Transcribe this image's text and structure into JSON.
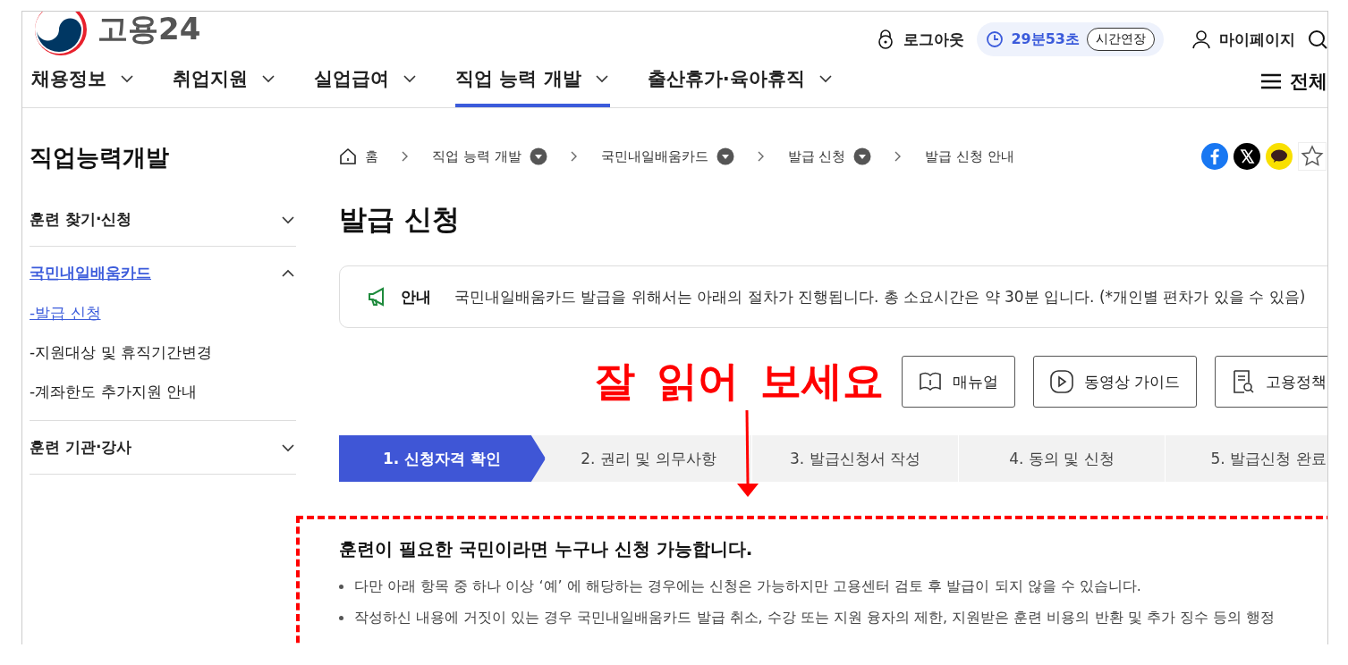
{
  "header": {
    "logo_text": "고용24",
    "utility": [
      {
        "kind": "logout",
        "label": "로그아웃"
      },
      {
        "kind": "timer",
        "label": "29분53초",
        "action": "시간연장"
      },
      {
        "kind": "mypage",
        "label": "마이페이지"
      },
      {
        "kind": "search"
      }
    ]
  },
  "nav": {
    "items": [
      {
        "label": "채용정보",
        "selected": false
      },
      {
        "label": "취업지원",
        "selected": false
      },
      {
        "label": "실업급여",
        "selected": false
      },
      {
        "label": "직업 능력 개발",
        "selected": true
      },
      {
        "label": "출산휴가·육아휴직",
        "selected": false
      }
    ],
    "all_menu": "전체"
  },
  "sidebar": {
    "title": "직업능력개발",
    "items": [
      {
        "label": "훈련 찾기·신청",
        "expanded": false,
        "selected": false
      },
      {
        "label": "국민내일배움카드",
        "expanded": true,
        "selected": true,
        "children": [
          {
            "label": "-발급 신청",
            "selected": true
          },
          {
            "label": "-지원대상 및 휴직기간변경",
            "selected": false
          },
          {
            "label": "-계좌한도 추가지원 안내",
            "selected": false
          }
        ]
      },
      {
        "label": "훈련 기관·강사",
        "expanded": false,
        "selected": false
      }
    ]
  },
  "breadcrumb": [
    {
      "label": "홈",
      "kind": "home"
    },
    {
      "label": "직업 능력 개발",
      "kind": "dropdown"
    },
    {
      "label": "국민내일배움카드",
      "kind": "dropdown"
    },
    {
      "label": "발급 신청",
      "kind": "dropdown"
    },
    {
      "label": "발급 신청 안내",
      "kind": "plain"
    }
  ],
  "share": [
    {
      "kind": "facebook"
    },
    {
      "kind": "x"
    },
    {
      "kind": "talk"
    },
    {
      "kind": "star"
    }
  ],
  "page_title": "발급 신청",
  "notice": {
    "label": "안내",
    "text": "국민내일배움카드 발급을 위해서는 아래의 절차가 진행됩니다. 총 소요시간은 약 30분 입니다. (*개인별 편차가 있을 수 있음)"
  },
  "annotation": {
    "text": "잘 읽어 보세요"
  },
  "guide_buttons": [
    {
      "kind": "manual",
      "label": "매뉴얼"
    },
    {
      "kind": "video",
      "label": "동영상 가이드"
    },
    {
      "kind": "policy",
      "label": "고용정책"
    }
  ],
  "steps": [
    {
      "label": "1. 신청자격 확인",
      "selected": true
    },
    {
      "label": "2. 권리 및 의무사항",
      "selected": false
    },
    {
      "label": "3. 발급신청서 작성",
      "selected": false
    },
    {
      "label": "4. 동의 및 신청",
      "selected": false
    },
    {
      "label": "5. 발급신청 완료",
      "selected": false
    }
  ],
  "content": {
    "heading": "훈련이 필요한 국민이라면 누구나 신청 가능합니다.",
    "bullets": [
      "다만 아래 항목 중 하나 이상 ‘예’ 에 해당하는 경우에는 신청은 가능하지만 고용센터 검토 후 발급이 되지 않을 수 있습니다.",
      "작성하신 내용에 거짓이 있는 경우 국민내일배움카드 발급 취소, 수강 또는 지원 융자의 제한, 지원받은 훈련 비용의 반환 및 추가 징수 등의 행정"
    ]
  }
}
